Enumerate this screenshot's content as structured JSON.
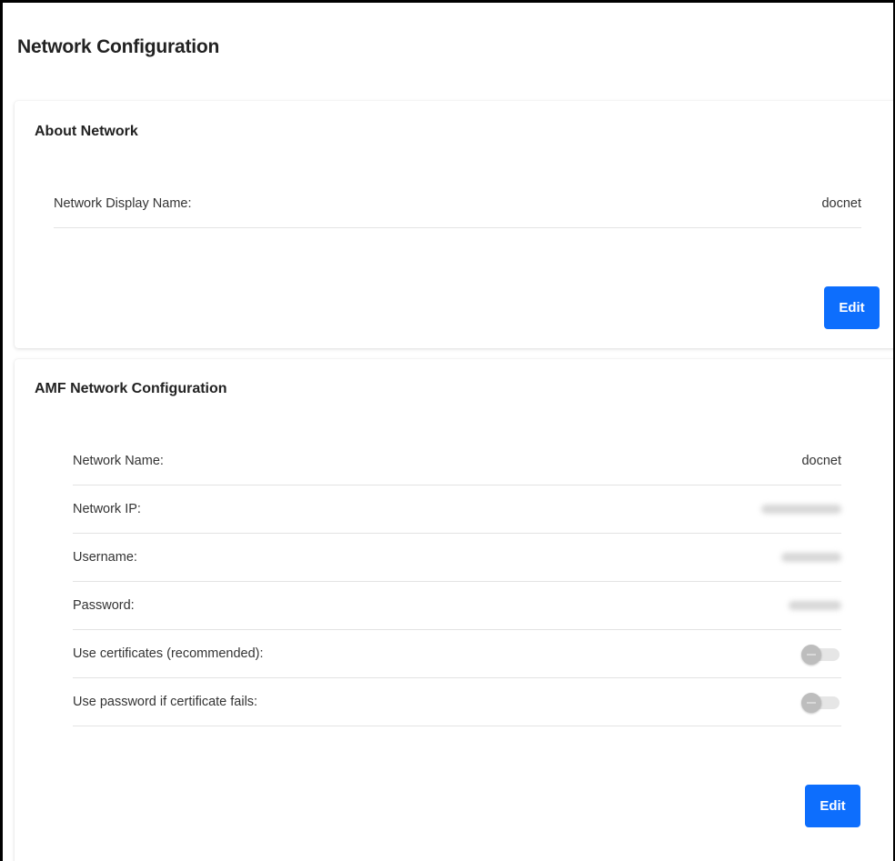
{
  "page": {
    "title": "Network Configuration"
  },
  "about_network": {
    "title": "About Network",
    "rows": [
      {
        "label": "Network Display Name:",
        "value": "docnet"
      }
    ],
    "edit_label": "Edit"
  },
  "amf_network": {
    "title": "AMF Network Configuration",
    "rows": [
      {
        "label": "Network Name:",
        "value": "docnet"
      },
      {
        "label": "Network IP:",
        "value": ""
      },
      {
        "label": "Username:",
        "value": ""
      },
      {
        "label": "Password:",
        "value": ""
      }
    ],
    "toggles": [
      {
        "label": "Use certificates (recommended):",
        "enabled": false
      },
      {
        "label": "Use password if certificate fails:",
        "enabled": false
      }
    ],
    "edit_label": "Edit"
  },
  "colors": {
    "accent": "#0d6efd",
    "toggle_off": "#bdbdbd"
  }
}
